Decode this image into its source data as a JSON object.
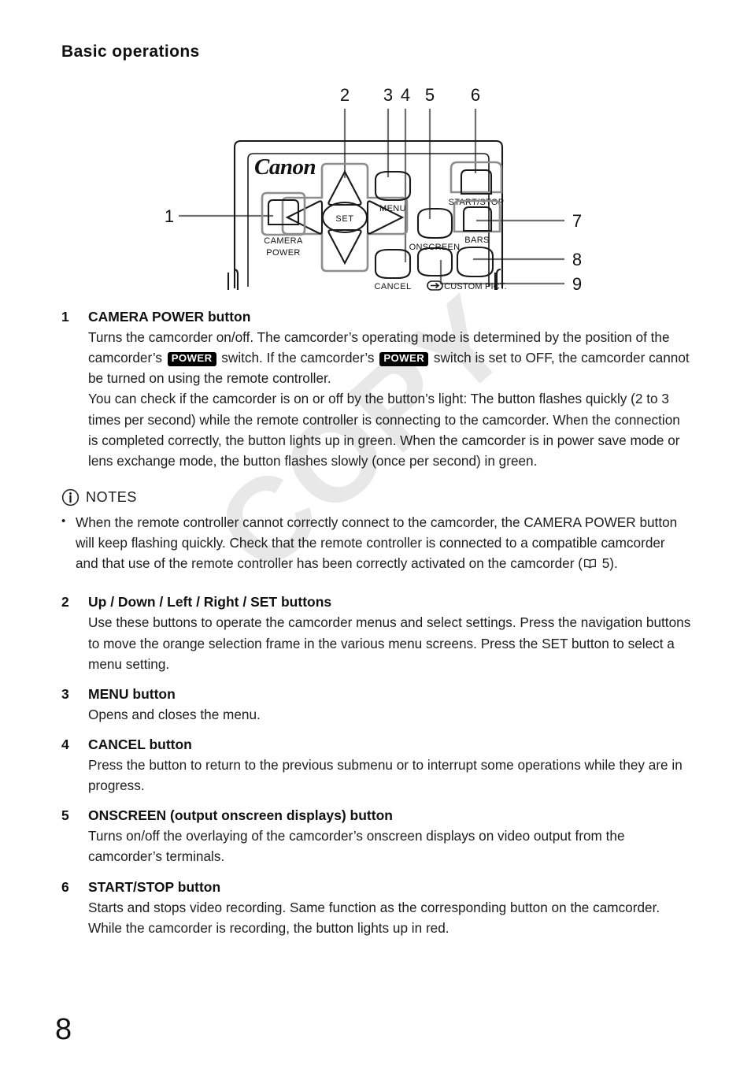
{
  "document": {
    "running_head": "Basic operations",
    "page_number": "8",
    "watermark": "COPY"
  },
  "figure": {
    "brand_logo": "Canon",
    "callouts_top": [
      "2",
      "3",
      "4",
      "5",
      "6"
    ],
    "callout_left": "1",
    "callouts_right": [
      "7",
      "8",
      "9"
    ],
    "button_labels": {
      "camera_power_line1": "CAMERA",
      "camera_power_line2": "POWER",
      "set": "SET",
      "menu": "MENU",
      "cancel": "CANCEL",
      "onscreen": "ONSCREEN",
      "start_stop": "START/STOP",
      "bars": "BARS",
      "custom_pict": "CUSTOM PICT."
    }
  },
  "entries": [
    {
      "num": "1",
      "title": "CAMERA POWER button",
      "paragraphs": [
        {
          "segments": [
            {
              "type": "text",
              "value": "Turns the camcorder on/off. The camcorder’s operating mode is determined by the position of the camcorder’s "
            },
            {
              "type": "badge",
              "value": "POWER"
            },
            {
              "type": "text",
              "value": " switch. If the camcorder’s "
            },
            {
              "type": "badge",
              "value": "POWER"
            },
            {
              "type": "text",
              "value": " switch is set to OFF, the camcorder cannot be turned on using the remote controller."
            }
          ]
        },
        {
          "segments": [
            {
              "type": "text",
              "value": "You can check if the camcorder is on or off by the button’s light: The button flashes quickly (2 to 3 times per second) while the remote controller is connecting to the camcorder. When the connection is completed correctly, the button lights up in green. When the camcorder is in power save mode or lens exchange mode, the button flashes slowly (once per second) in green."
            }
          ]
        }
      ]
    },
    {
      "num": "2",
      "title": "Up / Down / Left / Right / SET buttons",
      "paragraphs": [
        {
          "segments": [
            {
              "type": "text",
              "value": "Use these buttons to operate the camcorder menus and select settings. Press the navigation buttons to move the orange selection frame in the various menu screens. Press the SET button to select a menu setting."
            }
          ]
        }
      ]
    },
    {
      "num": "3",
      "title": "MENU button",
      "paragraphs": [
        {
          "segments": [
            {
              "type": "text",
              "value": "Opens and closes the menu."
            }
          ]
        }
      ]
    },
    {
      "num": "4",
      "title": "CANCEL button",
      "paragraphs": [
        {
          "segments": [
            {
              "type": "text",
              "value": "Press the button to return to the previous submenu or to interrupt some operations while they are in progress."
            }
          ]
        }
      ]
    },
    {
      "num": "5",
      "title": "ONSCREEN (output onscreen displays) button",
      "paragraphs": [
        {
          "segments": [
            {
              "type": "text",
              "value": "Turns on/off the overlaying of the camcorder’s onscreen displays on video output from the camcorder’s terminals."
            }
          ]
        }
      ]
    },
    {
      "num": "6",
      "title": "START/STOP button",
      "paragraphs": [
        {
          "segments": [
            {
              "type": "text",
              "value": "Starts and stops video recording. Same function as the corresponding button on the camcorder."
            }
          ]
        },
        {
          "segments": [
            {
              "type": "text",
              "value": "While the camcorder is recording, the button lights up in red."
            }
          ]
        }
      ]
    }
  ],
  "notes": {
    "label": "NOTES",
    "bullet": "•",
    "items": [
      {
        "segments": [
          {
            "type": "text",
            "value": "When the remote controller cannot correctly connect to the camcorder, the CAMERA POWER button will keep flashing quickly. Check that the remote controller is connected to a compatible camcorder and that use of the remote controller has been correctly activated on the camcorder ("
          },
          {
            "type": "book",
            "value": "book-icon"
          },
          {
            "type": "text",
            "value": " 5)."
          }
        ]
      }
    ]
  },
  "colors": {
    "text": "#1d1d1d",
    "badge_bg": "#000000",
    "badge_fg": "#ffffff",
    "line_gray": "#8a8a8a",
    "outline": "#1a1a1a",
    "watermark": "#e8e8e8"
  }
}
